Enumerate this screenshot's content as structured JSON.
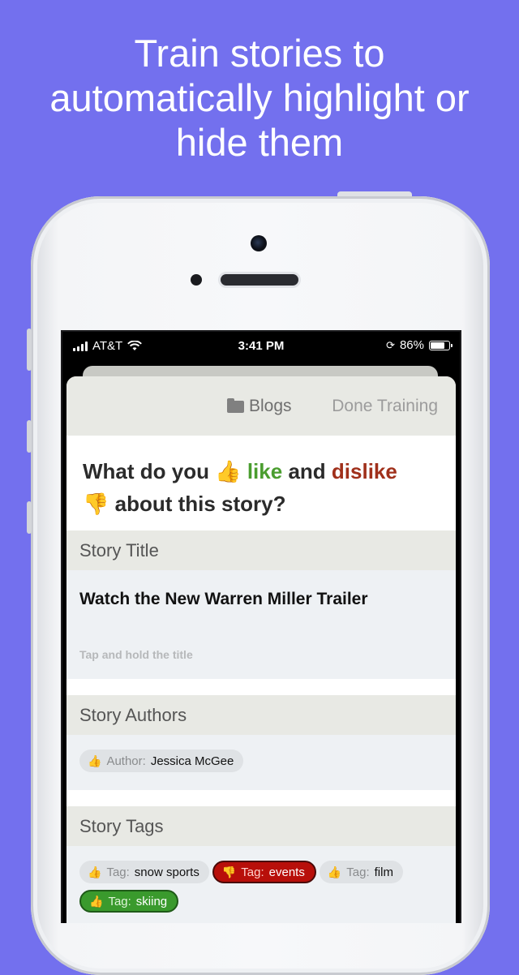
{
  "headline": [
    "Train stories to",
    "automatically highlight or",
    "hide them"
  ],
  "status_bar": {
    "carrier": "AT&T",
    "time": "3:41 PM",
    "battery": "86%",
    "battery_level": 0.86
  },
  "nav": {
    "blogs_label": "Blogs",
    "done_label": "Done Training"
  },
  "question": {
    "part1": "What do you",
    "like_emoji": "👍",
    "like": "like",
    "and": "and",
    "dislike": "dislike",
    "dislike_emoji": "👎",
    "part2": "about this story?"
  },
  "sections": {
    "title": {
      "header": "Story Title",
      "value": "Watch the New Warren Miller Trailer",
      "hint": "Tap and hold the title"
    },
    "authors": {
      "header": "Story Authors",
      "chips": [
        {
          "label": "Author:",
          "value": "Jessica McGee"
        }
      ]
    },
    "tags": {
      "header": "Story Tags",
      "chips": [
        {
          "label": "Tag:",
          "value": "snow sports",
          "state": "neutral"
        },
        {
          "label": "Tag:",
          "value": "events",
          "state": "dislike"
        },
        {
          "label": "Tag:",
          "value": "film",
          "state": "neutral"
        },
        {
          "label": "Tag:",
          "value": "skiing",
          "state": "like"
        }
      ]
    }
  },
  "colors": {
    "background": "#7370ee",
    "like": "#4a9d2f",
    "dislike": "#a0301b"
  }
}
